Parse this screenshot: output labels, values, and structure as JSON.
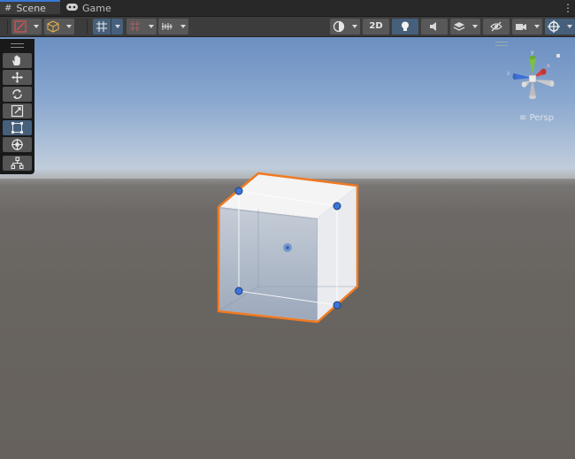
{
  "tabs": [
    {
      "label": "Scene",
      "icon": "grid-icon",
      "active": true
    },
    {
      "label": "Game",
      "icon": "gamepad-icon",
      "active": false
    }
  ],
  "toolbar": {
    "two_d_label": "2D",
    "buttons": [
      "gizmo-pivot",
      "shading-cube",
      "grid-snap",
      "increment-snap",
      "ruler",
      "shading-mode",
      "2d-toggle",
      "lighting-toggle",
      "audio-toggle",
      "effects",
      "visibility",
      "camera",
      "gizmos"
    ]
  },
  "tools": [
    {
      "name": "hand",
      "icon": "hand-icon",
      "selected": false
    },
    {
      "name": "move",
      "icon": "move-icon",
      "selected": false
    },
    {
      "name": "rotate",
      "icon": "rotate-icon",
      "selected": false
    },
    {
      "name": "scale",
      "icon": "scale-icon",
      "selected": false
    },
    {
      "name": "rect",
      "icon": "rect-transform-icon",
      "selected": true
    },
    {
      "name": "transform",
      "icon": "transform-icon",
      "selected": false
    },
    {
      "name": "custom",
      "icon": "custom-tool-icon",
      "selected": false
    }
  ],
  "gizmo": {
    "projection_label": "Persp"
  },
  "colors": {
    "selection_outline": "#f07a22",
    "rect_handle": "#3b74d9",
    "active_tool": "#46607c",
    "tab_accent": "#3a79d6"
  }
}
